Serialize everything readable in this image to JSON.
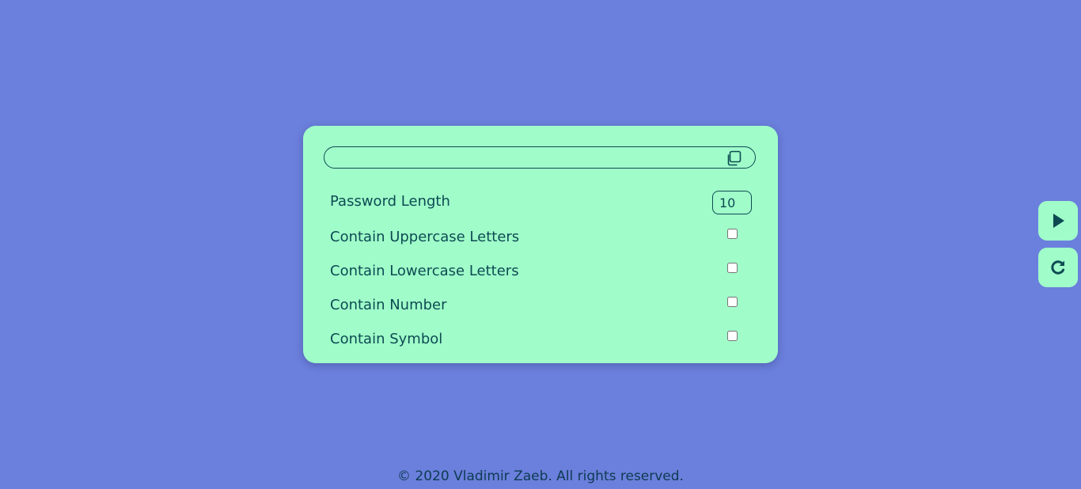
{
  "generator": {
    "result_value": "",
    "rows": {
      "length": {
        "label": "Password Length",
        "value": "10"
      },
      "uppercase": {
        "label": "Contain Uppercase Letters",
        "checked": false
      },
      "lowercase": {
        "label": "Contain Lowercase Letters",
        "checked": false
      },
      "number": {
        "label": "Contain Number",
        "checked": false
      },
      "symbol": {
        "label": "Contain Symbol",
        "checked": false
      }
    },
    "icons": {
      "copy": "copy-icon",
      "generate": "play-icon",
      "reset": "refresh-icon"
    }
  },
  "footer": {
    "text": "© 2020 Vladimir Zaeb. All rights reserved."
  },
  "colors": {
    "background": "#6b7fdc",
    "card": "#a0fdca",
    "text": "#0d4a52"
  }
}
